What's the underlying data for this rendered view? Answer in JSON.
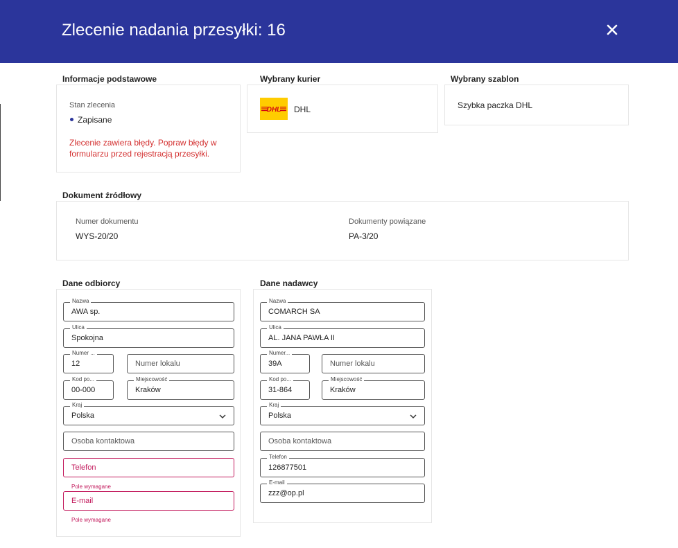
{
  "header": {
    "title": "Zlecenie nadania przesyłki: 16"
  },
  "basic": {
    "section_title": "Informacje podstawowe",
    "status_label": "Stan zlecenia",
    "status_value": "Zapisane",
    "error_message": "Zlecenie zawiera błędy. Popraw błędy w formularzu przed rejestracją przesyłki."
  },
  "courier": {
    "section_title": "Wybrany kurier",
    "name": "DHL",
    "logo_text": "DHL"
  },
  "template": {
    "section_title": "Wybrany szablon",
    "name": "Szybka paczka DHL"
  },
  "source_doc": {
    "section_title": "Dokument źródłowy",
    "doc_number_label": "Numer dokumentu",
    "doc_number": "WYS-20/20",
    "related_label": "Dokumenty powiązane",
    "related": "PA-3/20"
  },
  "recipient": {
    "section_title": "Dane odbiorcy",
    "name_label": "Nazwa",
    "name": "AWA sp.",
    "street_label": "Ulica",
    "street": "Spokojna",
    "number_label": "Numer ...",
    "number": "12",
    "apt_placeholder": "Numer lokalu",
    "zip_label": "Kod po...",
    "zip": "00-000",
    "city_label": "Miejscowość",
    "city": "Kraków",
    "country_label": "Kraj",
    "country": "Polska",
    "contact_placeholder": "Osoba kontaktowa",
    "phone_placeholder": "Telefon",
    "phone_hint": "Pole wymagane",
    "email_placeholder": "E-mail",
    "email_hint": "Pole wymagane"
  },
  "sender": {
    "section_title": "Dane nadawcy",
    "name_label": "Nazwa",
    "name": "COMARCH SA",
    "street_label": "Ulica",
    "street": "AL. JANA PAWŁA II",
    "number_label": "Numer...",
    "number": "39A",
    "apt_placeholder": "Numer lokalu",
    "zip_label": "Kod po...",
    "zip": "31-864",
    "city_label": "Miejscowość",
    "city": "Kraków",
    "country_label": "Kraj",
    "country": "Polska",
    "contact_placeholder": "Osoba kontaktowa",
    "phone_label": "Telefon",
    "phone": "126877501",
    "email_label": "E-mail",
    "email": "zzz@op.pl"
  },
  "colors": {
    "header_bg": "#2b359b",
    "error": "#d32f2f",
    "field_error": "#c2185b",
    "dhl_yellow": "#ffcc00",
    "dhl_red": "#d40511"
  }
}
